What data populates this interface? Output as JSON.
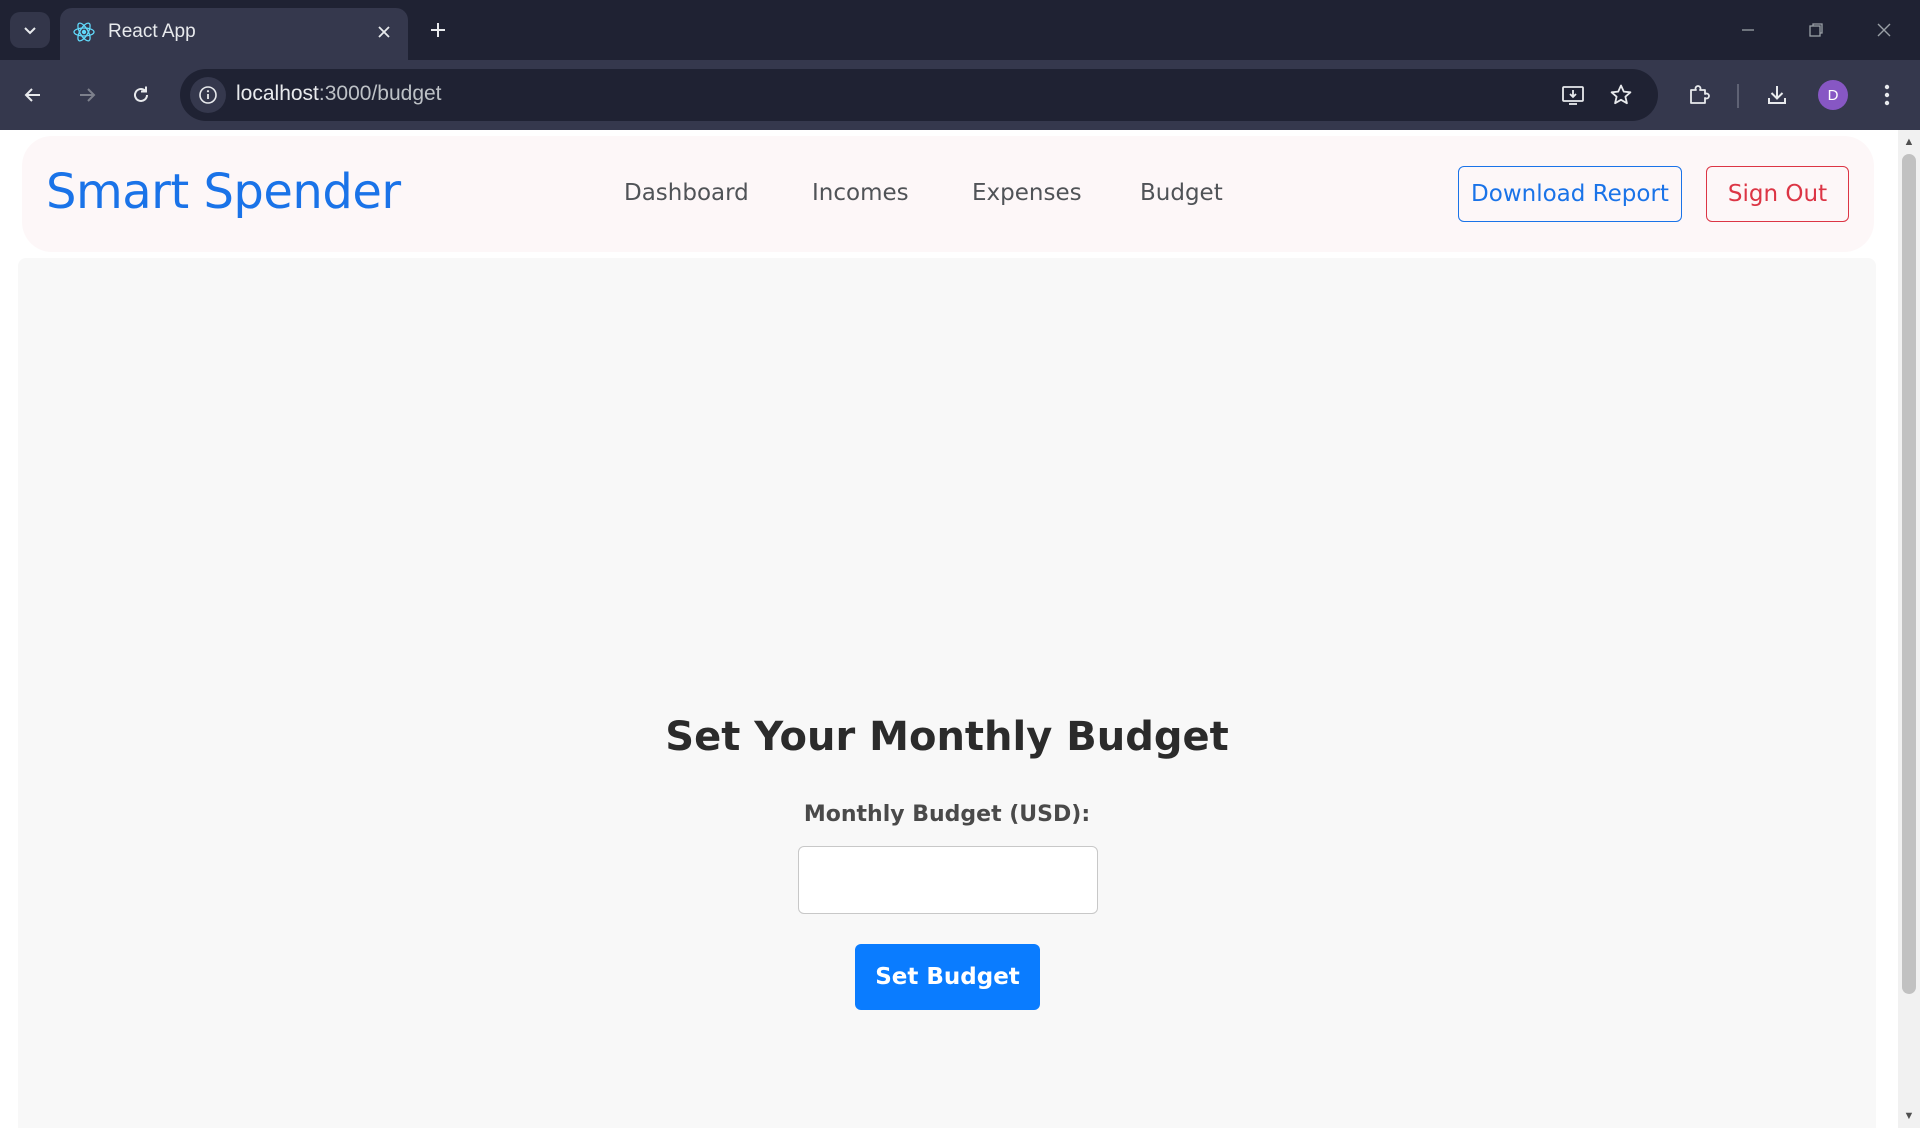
{
  "browser": {
    "tab_title": "React App",
    "url_host": "localhost",
    "url_rest": ":3000/budget",
    "profile_initial": "D",
    "icons": {
      "tab_list": "chevron-down-icon",
      "favicon": "react-logo-icon",
      "tab_close": "close-icon",
      "new_tab": "plus-icon",
      "minimize": "minimize-icon",
      "restore": "restore-icon",
      "window_close": "close-icon",
      "back": "arrow-left-icon",
      "forward": "arrow-right-icon",
      "reload": "reload-icon",
      "site_info": "info-icon",
      "install_app": "install-app-icon",
      "bookmark": "star-icon",
      "extensions": "puzzle-icon",
      "downloads": "download-icon",
      "menu": "kebab-menu-icon"
    }
  },
  "navbar": {
    "brand": "Smart Spender",
    "links": [
      "Dashboard",
      "Incomes",
      "Expenses",
      "Budget"
    ],
    "download_report": "Download Report",
    "sign_out": "Sign Out"
  },
  "main": {
    "heading": "Set Your Monthly Budget",
    "field_label": "Monthly Budget (USD):",
    "budget_value": "",
    "submit_label": "Set Budget"
  },
  "colors": {
    "brand": "#1a73e8",
    "primary_button": "#0a7cff",
    "danger": "#dc3545",
    "navbar_bg": "#fdf7f8",
    "content_bg": "#f8f8f8",
    "browser_frame": "#1f2233",
    "browser_toolbar": "#35384d"
  }
}
